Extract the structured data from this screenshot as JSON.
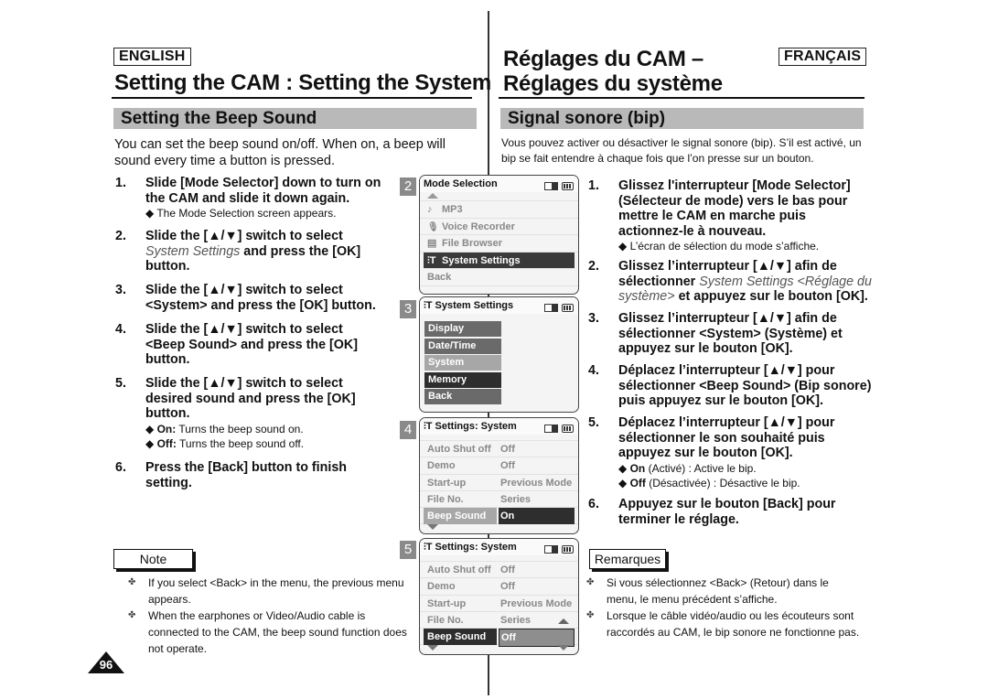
{
  "header": {
    "lang_en": "ENGLISH",
    "lang_fr": "FRANÇAIS",
    "title_en": "Setting the CAM : Setting the System",
    "title_fr_line1": "Réglages du CAM –",
    "title_fr_line2": "Réglages du système"
  },
  "section": {
    "en": "Setting the Beep Sound",
    "fr": "Signal sonore (bip)"
  },
  "intro": {
    "en": "You can set the beep sound on/off. When on, a beep will sound every time a button is pressed.",
    "fr": "Vous pouvez activer ou désactiver le signal sonore (bip). S’il est activé, un bip se fait entendre à chaque fois que l’on presse sur un bouton."
  },
  "steps_en": [
    {
      "num": "1.",
      "l1": "Slide [Mode Selector] down to turn on",
      "l2": "the CAM and slide it down again.",
      "sub": "◆ The Mode Selection screen appears."
    },
    {
      "num": "2.",
      "l1": "Slide the [▲/▼] switch to select",
      "l2_ital": "System Settings",
      "l2_rest": " and press the [OK]",
      "l3": "button."
    },
    {
      "num": "3.",
      "l1": "Slide the [▲/▼] switch to select",
      "l2": "<System> and press the [OK] button."
    },
    {
      "num": "4.",
      "l1": "Slide the [▲/▼] switch to select",
      "l2": "<Beep Sound> and press the [OK]",
      "l3": "button."
    },
    {
      "num": "5.",
      "l1": "Slide the [▲/▼] switch to select",
      "l2": "desired sound and press the [OK]",
      "l3": "button.",
      "sub1_b": "On:",
      "sub1": " Turns the beep sound on.",
      "sub2_b": "Off:",
      "sub2": " Turns the beep sound off."
    },
    {
      "num": "6.",
      "l1": "Press the [Back] button to finish",
      "l2": "setting."
    }
  ],
  "steps_fr": [
    {
      "num": "1.",
      "l1": "Glissez l'interrupteur [Mode Selector]",
      "l2": "(Sélecteur de mode) vers le bas pour",
      "l3": "mettre le CAM en marche puis",
      "l4": "actionnez-le à nouveau.",
      "sub": "◆ L’écran de sélection du mode s’affiche."
    },
    {
      "num": "2.",
      "l1": "Glissez l’interrupteur [▲/▼] afin de",
      "l2_pre": "sélectionner ",
      "l2_ital": "System Settings <Réglage du",
      "l3_ital": "système>",
      "l3_rest": " et appuyez sur le bouton [OK]."
    },
    {
      "num": "3.",
      "l1": "Glissez l’interrupteur [▲/▼] afin de",
      "l2": "sélectionner <System> (Système) et",
      "l3": "appuyez sur le bouton [OK]."
    },
    {
      "num": "4.",
      "l1": "Déplacez l’interrupteur [▲/▼] pour",
      "l2": "sélectionner <Beep Sound> (Bip sonore)",
      "l3": "puis appuyez sur le bouton [OK]."
    },
    {
      "num": "5.",
      "l1": "Déplacez l’interrupteur [▲/▼] pour",
      "l2": "sélectionner le son souhaité puis",
      "l3": "appuyez sur le bouton [OK].",
      "sub1_b": "On",
      "sub1": " (Activé) :  Active le bip.",
      "sub2_b": "Off",
      "sub2": " (Désactivée) : Désactive le bip."
    },
    {
      "num": "6.",
      "l1": "Appuyez sur le bouton [Back] pour",
      "l2": "terminer le réglage."
    }
  ],
  "screens": {
    "s2": {
      "num": "2",
      "title": "Mode Selection",
      "items": [
        {
          "icon": "♪",
          "label": "MP3"
        },
        {
          "icon": "🎙",
          "label": "Voice Recorder"
        },
        {
          "icon": "▤",
          "label": "File Browser"
        },
        {
          "icon": "⫶T",
          "label": "System Settings"
        },
        {
          "label": "Back"
        }
      ]
    },
    "s3": {
      "num": "3",
      "title_icon": "⫶T",
      "title": "System Settings",
      "items": [
        "Display",
        "Date/Time",
        "System",
        "Memory",
        "Back"
      ]
    },
    "s4": {
      "num": "4",
      "title_icon": "⫶T",
      "title": "Settings: System",
      "rows": [
        {
          "label": "Auto Shut off",
          "value": "Off"
        },
        {
          "label": "Demo",
          "value": "Off"
        },
        {
          "label": "Start-up",
          "value": "Previous Mode"
        },
        {
          "label": "File No.",
          "value": "Series"
        },
        {
          "label": "Beep Sound",
          "value": "On"
        }
      ]
    },
    "s5": {
      "num": "5",
      "title_icon": "⫶T",
      "title": "Settings: System",
      "rows": [
        {
          "label": "Auto Shut off",
          "value": "Off"
        },
        {
          "label": "Demo",
          "value": "Off"
        },
        {
          "label": "Start-up",
          "value": "Previous Mode"
        },
        {
          "label": "File No.",
          "value": "Series"
        },
        {
          "label": "Beep Sound",
          "value": "Off"
        }
      ]
    }
  },
  "notes": {
    "en_title": "Note",
    "fr_title": "Remarques",
    "bullet": "✤",
    "en": [
      "If you select <Back> in the menu, the previous menu appears.",
      "When the earphones or Video/Audio cable is connected to the CAM, the beep sound function does not operate."
    ],
    "fr": [
      "Si vous sélectionnez <Back> (Retour) dans le menu, le menu précédent s’affiche.",
      "Lorsque le câble vidéo/audio ou les écouteurs sont raccordés au CAM, le bip sonore ne fonctionne pas."
    ]
  },
  "page_number": "96"
}
